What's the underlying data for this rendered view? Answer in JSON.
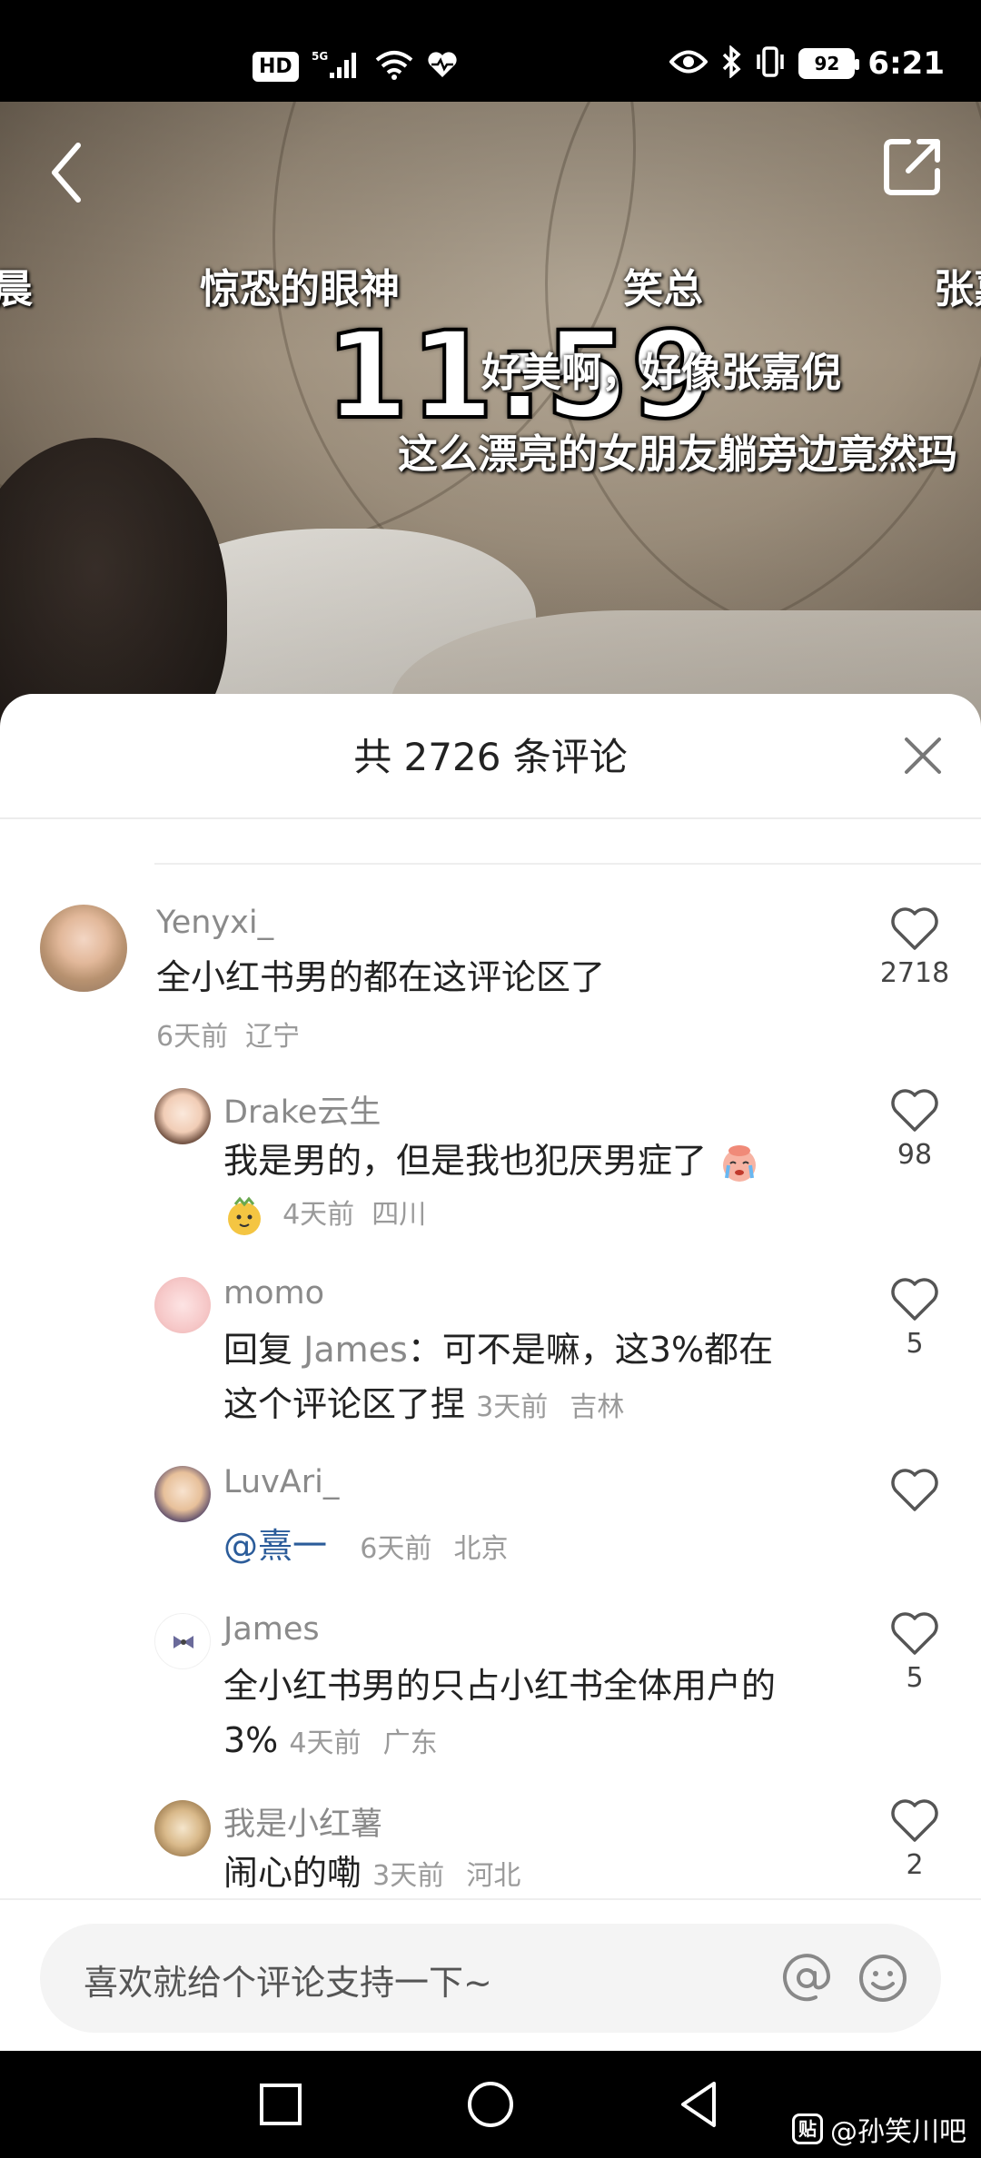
{
  "status_bar": {
    "left_label": "HD",
    "network": "5G",
    "battery": "92",
    "time": "6:21"
  },
  "video": {
    "danmaku": [
      "晨",
      "惊恐的眼神",
      "笑总",
      "张嘉",
      "好美啊，好像张嘉倪",
      "这么漂亮的女朋友躺旁边竟然玛"
    ],
    "clock_overlay": "11:59"
  },
  "comments_panel": {
    "title": "共 2726 条评论",
    "comments": [
      {
        "user": "Yenyxi_",
        "text": "全小红书男的都在这评论区了",
        "time": "6天前",
        "location": "辽宁",
        "likes": "2718"
      },
      {
        "user": "Drake云生",
        "text": "我是男的，但是我也犯厌男症了",
        "time": "4天前",
        "location": "四川",
        "likes": "98"
      },
      {
        "user": "momo",
        "reply_prefix": "回复",
        "reply_to": "James",
        "text_line1": "：可不是嘛，这3%都在",
        "text_line2": "这个评论区了捏",
        "time": "3天前",
        "location": "吉林",
        "likes": "5"
      },
      {
        "user": "LuvAri_",
        "mention": "@熹一",
        "time": "6天前",
        "location": "北京",
        "likes": ""
      },
      {
        "user": "James",
        "text_line1": "全小红书男的只占小红书全体用户的",
        "text_line2": "3%",
        "time": "4天前",
        "location": "广东",
        "likes": "5"
      },
      {
        "user": "我是小红薯",
        "text": "闹心的嘞",
        "time": "3天前",
        "location": "河北",
        "likes": "2"
      }
    ]
  },
  "input_bar": {
    "placeholder": "喜欢就给个评论支持一下~"
  },
  "watermark": {
    "badge": "贴",
    "text": "@孙笑川吧"
  }
}
